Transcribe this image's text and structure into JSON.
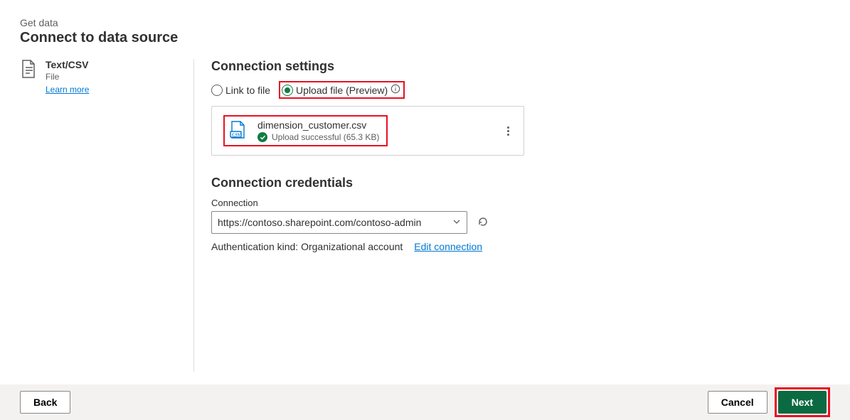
{
  "header": {
    "breadcrumb": "Get data",
    "title": "Connect to data source"
  },
  "sidebar": {
    "source_name": "Text/CSV",
    "source_subtitle": "File",
    "learn_more_label": "Learn more"
  },
  "settings": {
    "section_title": "Connection settings",
    "radio_link_label": "Link to file",
    "radio_upload_label": "Upload file (Preview)",
    "file": {
      "name": "dimension_customer.csv",
      "status": "Upload successful (65.3 KB)"
    }
  },
  "credentials": {
    "section_title": "Connection credentials",
    "connection_label": "Connection",
    "connection_value": "https://contoso.sharepoint.com/contoso-admin",
    "auth_kind_text": "Authentication kind: Organizational account",
    "edit_link_label": "Edit connection"
  },
  "footer": {
    "back_label": "Back",
    "cancel_label": "Cancel",
    "next_label": "Next"
  }
}
